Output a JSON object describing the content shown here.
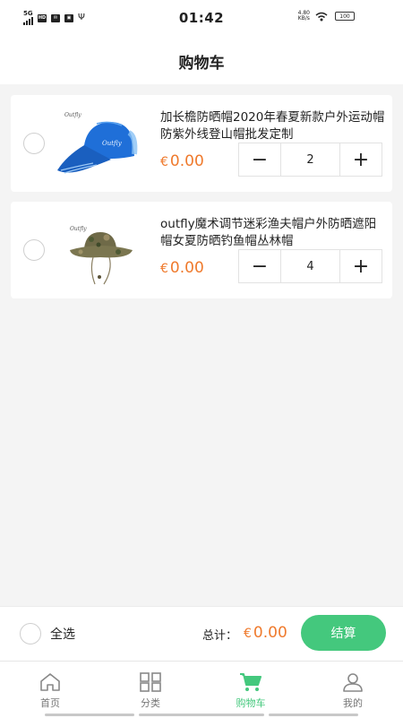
{
  "status_bar": {
    "network": "5G",
    "hd": "HD",
    "time": "01:42",
    "speed_value": "4.80",
    "speed_unit": "KB/s",
    "battery": "100"
  },
  "header": {
    "title": "购物车"
  },
  "cart": {
    "items": [
      {
        "title": "加长檐防晒帽2020年春夏新款户外运动帽防紫外线登山帽批发定制",
        "currency": "€",
        "price": "0.00",
        "quantity": "2",
        "image_icon": "blue-sun-cap-image",
        "brand_mark": "Outfly"
      },
      {
        "title": "outfly魔术调节迷彩渔夫帽户外防晒遮阳帽女夏防晒钓鱼帽丛林帽",
        "currency": "€",
        "price": "0.00",
        "quantity": "4",
        "image_icon": "camo-bucket-hat-image",
        "brand_mark": "Outfly"
      }
    ]
  },
  "checkout": {
    "select_all_label": "全选",
    "total_label": "总计：",
    "currency": "€",
    "total": "0.00",
    "button_label": "结算"
  },
  "tabs": [
    {
      "label": "首页",
      "icon": "home-icon",
      "active": false
    },
    {
      "label": "分类",
      "icon": "grid-icon",
      "active": false
    },
    {
      "label": "购物车",
      "icon": "cart-icon",
      "active": true
    },
    {
      "label": "我的",
      "icon": "user-icon",
      "active": false
    }
  ],
  "colors": {
    "accent": "#44c87d",
    "price": "#ef7a2d",
    "background": "#f4f4f4"
  }
}
